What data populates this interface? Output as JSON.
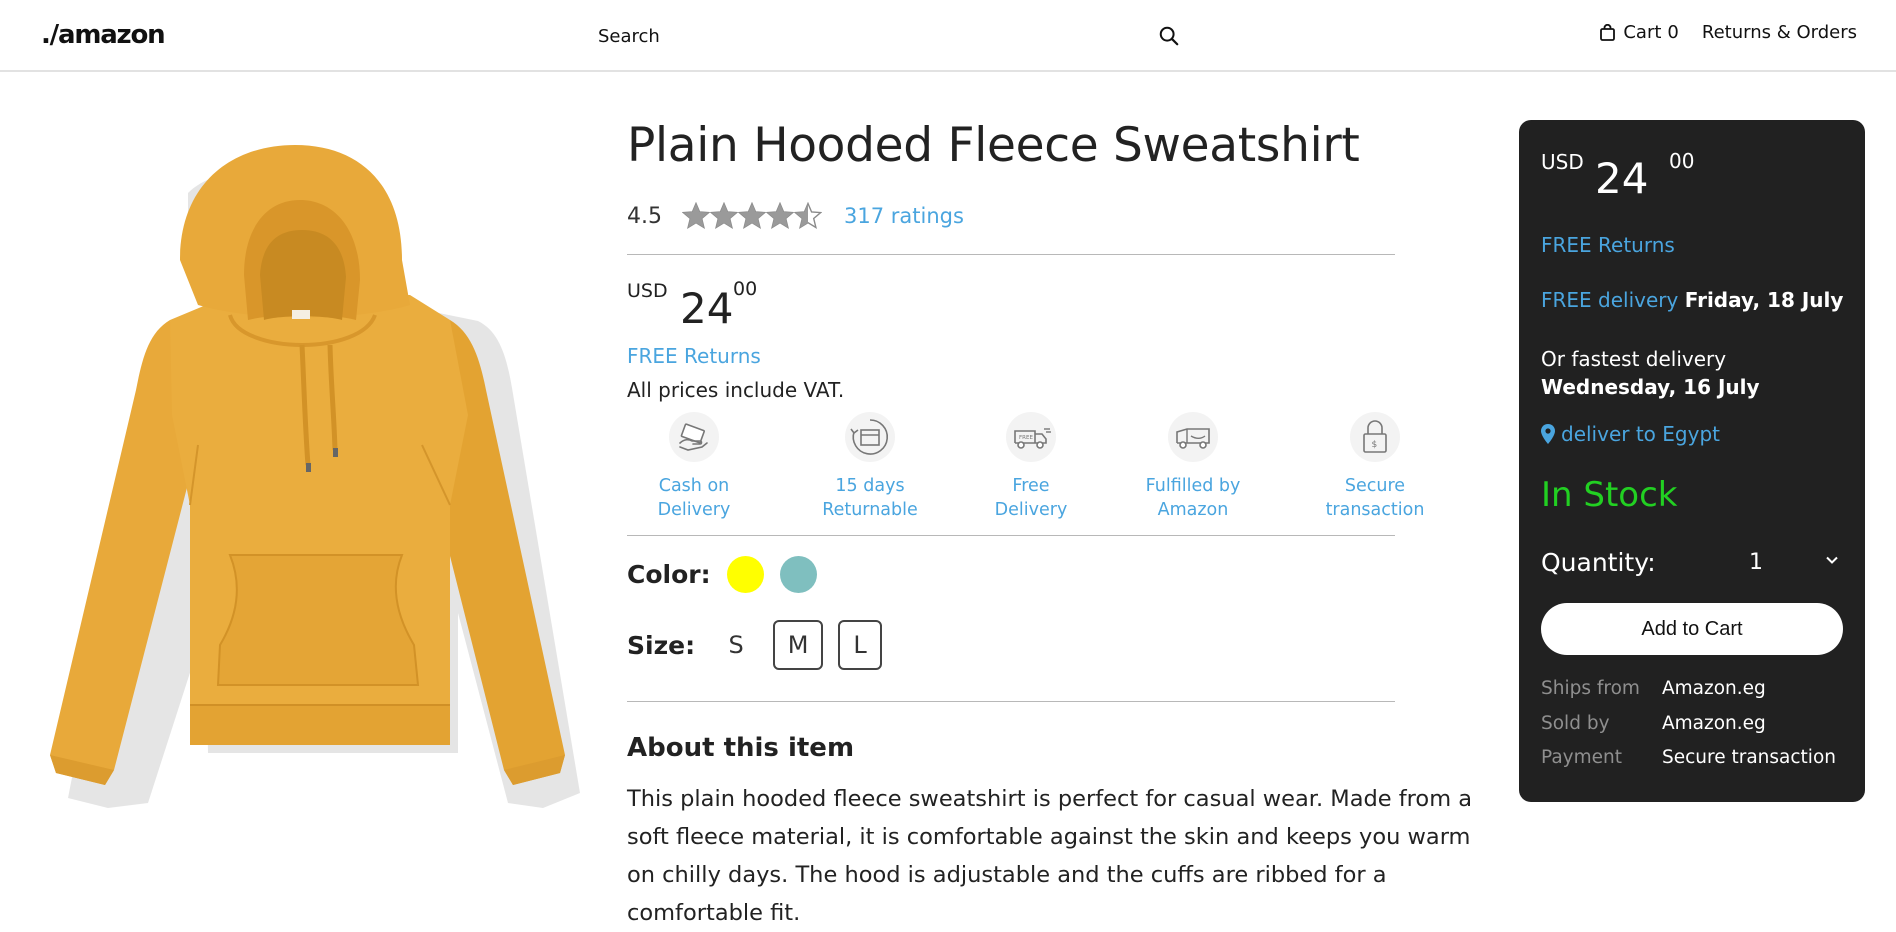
{
  "header": {
    "logo_text": "./amazon",
    "search_placeholder": "Search",
    "cart_label": "Cart",
    "cart_count": "0",
    "returns_orders_label": "Returns & Orders"
  },
  "product": {
    "title": "Plain Hooded Fleece Sweatshirt",
    "image_alt": "Mustard yellow hooded sweatshirt",
    "rating_value": "4.5",
    "rating_stars": 4.5,
    "ratings_link": "317 ratings",
    "price": {
      "currency": "USD",
      "whole": "24",
      "fraction": "00"
    },
    "free_returns": "FREE Returns",
    "vat_note": "All prices include VAT.",
    "features": [
      {
        "icon": "cash-on-delivery-icon",
        "label_line1": "Cash on",
        "label_line2": "Delivery"
      },
      {
        "icon": "returnable-box-icon",
        "label_line1": "15 days",
        "label_line2": "Returnable"
      },
      {
        "icon": "free-delivery-truck-icon",
        "label_line1": "Free",
        "label_line2": "Delivery"
      },
      {
        "icon": "fulfilled-by-amazon-icon",
        "label_line1": "Fulfilled by",
        "label_line2": "Amazon"
      },
      {
        "icon": "secure-padlock-icon",
        "label_line1": "Secure",
        "label_line2": "transaction"
      }
    ],
    "color_label": "Color:",
    "colors": [
      "#ffff00",
      "#7fbfbf"
    ],
    "size_label": "Size:",
    "sizes": [
      "S",
      "M",
      "L"
    ],
    "about_title": "About this item",
    "about_text": "This plain hooded fleece sweatshirt is perfect for casual wear. Made from a soft fleece material, it is comfortable against the skin and keeps you warm on chilly days. The hood is adjustable and the cuffs are ribbed for a comfortable fit."
  },
  "buybox": {
    "price": {
      "currency": "USD",
      "whole": "24",
      "fraction": "00"
    },
    "free_returns": "FREE Returns",
    "delivery_prefix": "FREE delivery",
    "delivery_date": "Friday, 18 July",
    "fastest_prefix": "Or fastest delivery",
    "fastest_date": "Wednesday, 16 July",
    "location": "deliver to Egypt",
    "stock_status": "In Stock",
    "quantity_label": "Quantity:",
    "quantity_value": "1",
    "add_to_cart": "Add to Cart",
    "ships_from_label": "Ships from",
    "ships_from_value": "Amazon.eg",
    "sold_by_label": "Sold by",
    "sold_by_value": "Amazon.eg",
    "payment_label": "Payment",
    "payment_value": "Secure transaction"
  },
  "colors": {
    "link_blue": "#4aa5df",
    "stock_green": "#22d022",
    "buybox_bg": "#212121",
    "hoodie": "#e8a93a"
  }
}
